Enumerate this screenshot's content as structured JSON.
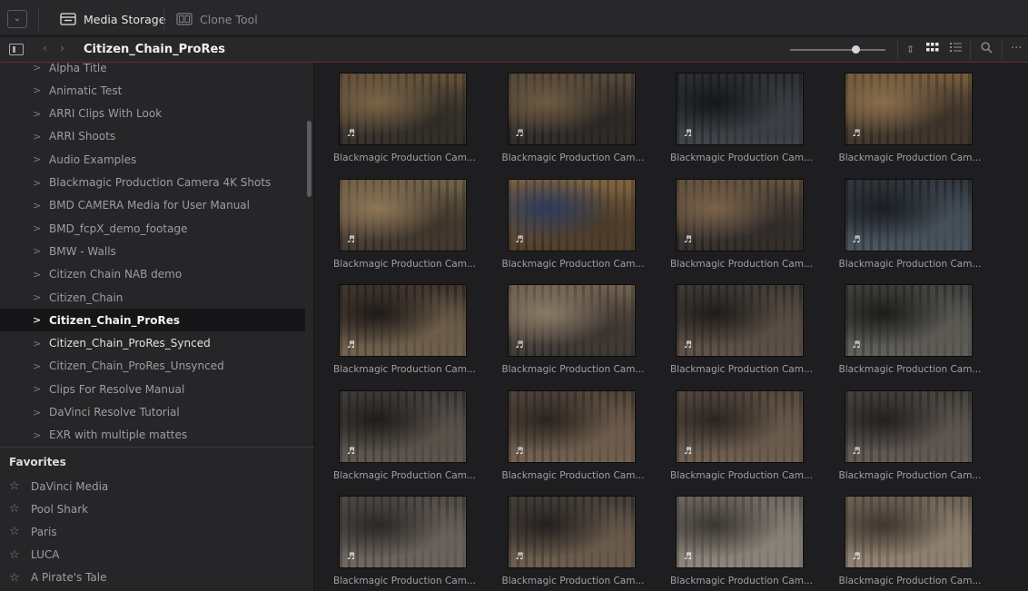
{
  "toolbar": {
    "tabs": [
      {
        "label": "Media Storage",
        "icon": "media-storage-icon",
        "active": true
      },
      {
        "label": "Clone Tool",
        "icon": "clone-tool-icon",
        "active": false
      }
    ]
  },
  "pathbar": {
    "title": "Citizen_Chain_ProRes",
    "zoom_level": 0.69
  },
  "tree": {
    "items": [
      "Alpha Title",
      "Animatic Test",
      "ARRI Clips With Look",
      "ARRI Shoots",
      "Audio Examples",
      "Blackmagic Production Camera 4K Shots",
      "BMD CAMERA Media for User Manual",
      "BMD_fcpX_demo_footage",
      "BMW - Walls",
      "Citizen Chain NAB demo",
      "Citizen_Chain",
      "Citizen_Chain_ProRes",
      "Citizen_Chain_ProRes_Synced",
      "Citizen_Chain_ProRes_Unsynced",
      "Clips For Resolve Manual",
      "DaVinci Resolve Tutorial",
      "EXR with multiple mattes"
    ],
    "selected_index": 11
  },
  "favorites": {
    "header": "Favorites",
    "items": [
      "DaVinci Media",
      "Pool Shark",
      "Paris",
      "LUCA",
      "A Pirate's Tale"
    ]
  },
  "clips": {
    "caption": "Blackmagic Production Cam...",
    "audio_glyph": "♬",
    "count": 20
  }
}
